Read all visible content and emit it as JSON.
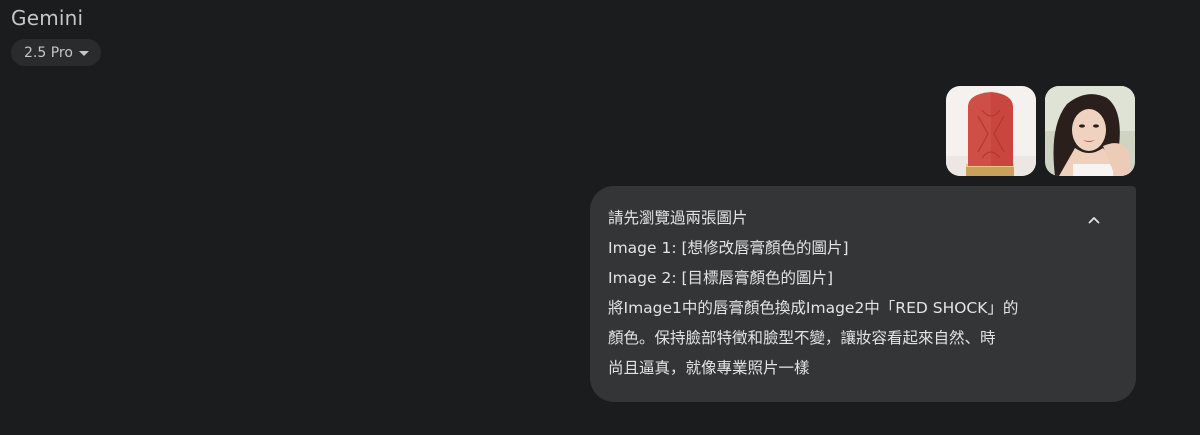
{
  "app": {
    "title": "Gemini",
    "model_label": "2.5 Pro"
  },
  "attachments": [
    {
      "name": "lipstick-image",
      "description_icon": "image-thumbnail"
    },
    {
      "name": "portrait-image",
      "description_icon": "image-thumbnail"
    }
  ],
  "message": {
    "lines": [
      "請先瀏覽過兩張圖片",
      "Image 1: [想修改唇膏顏色的圖片]",
      "Image 2: [目標唇膏顏色的圖片]",
      "將Image1中的唇膏顏色換成Image2中「RED SHOCK」的",
      "顏色。保持臉部特徵和臉型不變，讓妝容看起來自然、時",
      "尚且逼真，就像專業照片一樣"
    ]
  },
  "colors": {
    "background": "#1b1c1d",
    "bubble": "#333537",
    "chip": "#2a2b2d",
    "text": "#e3e3e3",
    "lipstick": "#c9463f"
  },
  "icons": {
    "model_dropdown": "caret-down-icon",
    "collapse": "chevron-up-icon"
  }
}
